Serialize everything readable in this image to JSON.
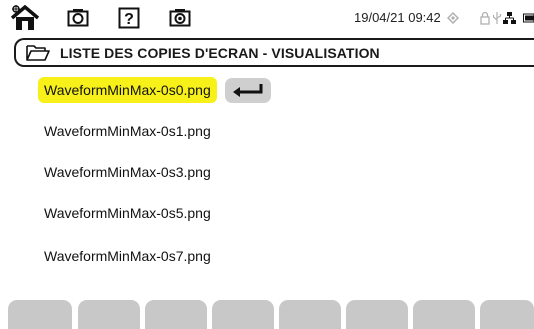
{
  "status_bar": {
    "datetime": "19/04/21 09:42",
    "icons": [
      "home-settings-icon",
      "camera-icon",
      "help-icon",
      "camera-alt-icon",
      "sync-icon",
      "lock-icon",
      "usb-icon",
      "network-icon",
      "battery-icon"
    ]
  },
  "title_bar": {
    "icon": "folder-icon",
    "title": "LISTE DES COPIES D'ECRAN - VISUALISATION"
  },
  "file_list": {
    "items": [
      {
        "name": "WaveformMinMax-0s0.png",
        "selected": true
      },
      {
        "name": "WaveformMinMax-0s1.png",
        "selected": false
      },
      {
        "name": "WaveformMinMax-0s3.png",
        "selected": false
      },
      {
        "name": "WaveformMinMax-0s5.png",
        "selected": false
      },
      {
        "name": "WaveformMinMax-0s7.png",
        "selected": false
      }
    ],
    "action_icon": "enter-return-icon"
  },
  "softkeys": {
    "count": 8,
    "labels": [
      "",
      "",
      "",
      "",
      "",
      "",
      "",
      ""
    ]
  },
  "colors": {
    "selection": "#f7f119",
    "button": "#cfcfcf",
    "softkey": "#c8c8c8",
    "border": "#1a1a1a"
  }
}
